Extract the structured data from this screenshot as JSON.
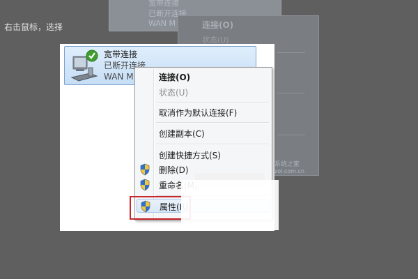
{
  "instruction": "右击鼠标，选择",
  "background_dup": {
    "name": "宽带连接",
    "status": "已断开连接",
    "type_partial": "WAN M",
    "menu_connect": "连接(O)",
    "menu_status": "状态(U)"
  },
  "connection": {
    "name": "宽带连接",
    "status": "已断开连接",
    "type": "WAN M"
  },
  "menu": {
    "connect": "连接(O)",
    "status": "状态(U)",
    "unset_default": "取消作为默认连接(F)",
    "copy": "创建副本(C)",
    "shortcut": "创建快捷方式(S)",
    "delete": "删除(D)",
    "rename": "重命名(M)",
    "properties": "属性(R)"
  },
  "watermark": {
    "line1": "系统之家",
    "line2": "zol.com.cn"
  },
  "colors": {
    "highlight": "#c8262c",
    "selection": "#c6def6",
    "background": "#5f5f5f"
  }
}
